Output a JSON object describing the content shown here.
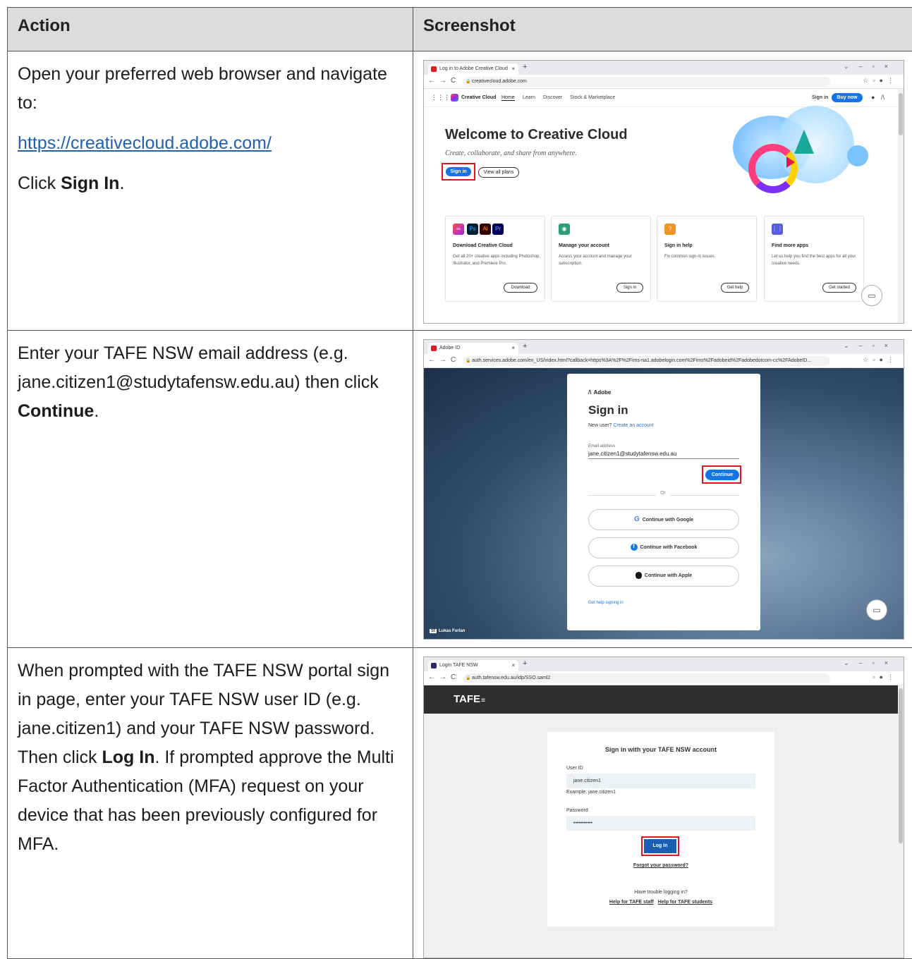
{
  "table": {
    "header_action": "Action",
    "header_screenshot": "Screenshot"
  },
  "rows": [
    {
      "p1": "Open your preferred web browser and navigate to:",
      "link": "https://creativecloud.adobe.com/",
      "p3_pre": "Click ",
      "p3_bold": "Sign In",
      "p3_post": "."
    },
    {
      "text": "Enter your TAFE NSW email address (e.g. jane.citizen1@studytafensw.edu.au) then click ",
      "bold": "Continue",
      "post": "."
    },
    {
      "text": "When prompted with the TAFE NSW portal sign in page, enter your TAFE NSW user ID (e.g. jane.citizen1) and your TAFE NSW password. Then click ",
      "bold": "Log In",
      "post": ". If prompted approve the Multi Factor Authentication (MFA) request on your device that has been previously configured for MFA."
    }
  ],
  "shot1": {
    "tab_title": "Log in to Adobe Creative Cloud",
    "url": "creativecloud.adobe.com",
    "nav_brand": "Creative Cloud",
    "nav_home": "Home",
    "nav_learn": "Learn",
    "nav_discover": "Discover",
    "nav_stock": "Stock & Marketplace",
    "nav_signin": "Sign in",
    "nav_buy": "Buy now",
    "hero_title": "Welcome to Creative Cloud",
    "hero_sub": "Create, collaborate, and share from anywhere.",
    "btn_signin": "Sign in",
    "btn_plans": "View all plans",
    "cards": [
      {
        "title": "Download Creative Cloud",
        "desc": "Get all 20+ creative apps including Photoshop, Illustrator, and Premiere Pro.",
        "btn": "Download"
      },
      {
        "title": "Manage your account",
        "desc": "Access your account and manage your subscription.",
        "btn": "Sign in"
      },
      {
        "title": "Sign in help",
        "desc": "Fix common sign-in issues.",
        "btn": "Get help"
      },
      {
        "title": "Find more apps",
        "desc": "Let us help you find the best apps for all your creative needs.",
        "btn": "Get started"
      }
    ],
    "app_ps": "Ps",
    "app_ai": "Ai",
    "app_pr": "Pr"
  },
  "shot2": {
    "tab_title": "Adobe ID",
    "url": "auth.services.adobe.com/en_US/index.html?callback=https%3A%2F%2Fims-na1.adobelogin.com%2Fims%2Fadobeid%2Fadobedotcom-cc%2FAdobeID...",
    "brand": "Adobe",
    "title": "Sign in",
    "new_user": "New user?",
    "create": "Create an account",
    "email_label": "Email address",
    "email_value": "jane.citizen1@studytafensw.edu.au",
    "continue": "Continue",
    "or": "Or",
    "google": "Continue with Google",
    "facebook": "Continue with Facebook",
    "apple": "Continue with Apple",
    "help": "Get help signing in",
    "credit": "Lukas Furlan",
    "credit_badge": "St"
  },
  "shot3": {
    "tab_title": "Login TAFE NSW",
    "url": "auth.tafensw.edu.au/idp/SSO.saml2",
    "logo": "TAFE",
    "heading": "Sign in with your TAFE NSW account",
    "userid_label": "User ID",
    "userid_value": "jane.citizen1",
    "example": "Example: jane.citizen1",
    "password_label": "Password",
    "password_value": "•••••••••••",
    "login": "Log In",
    "forgot": "Forgot your password?",
    "trouble": "Have trouble logging in?",
    "help_staff": "Help for TAFE staff",
    "help_students": "Help for TAFE students"
  },
  "colors": {
    "red_highlight": "#e0141e",
    "adobe_blue": "#1473e6",
    "tafe_blue": "#1a5fb4",
    "link_blue": "#1f5fb8"
  }
}
